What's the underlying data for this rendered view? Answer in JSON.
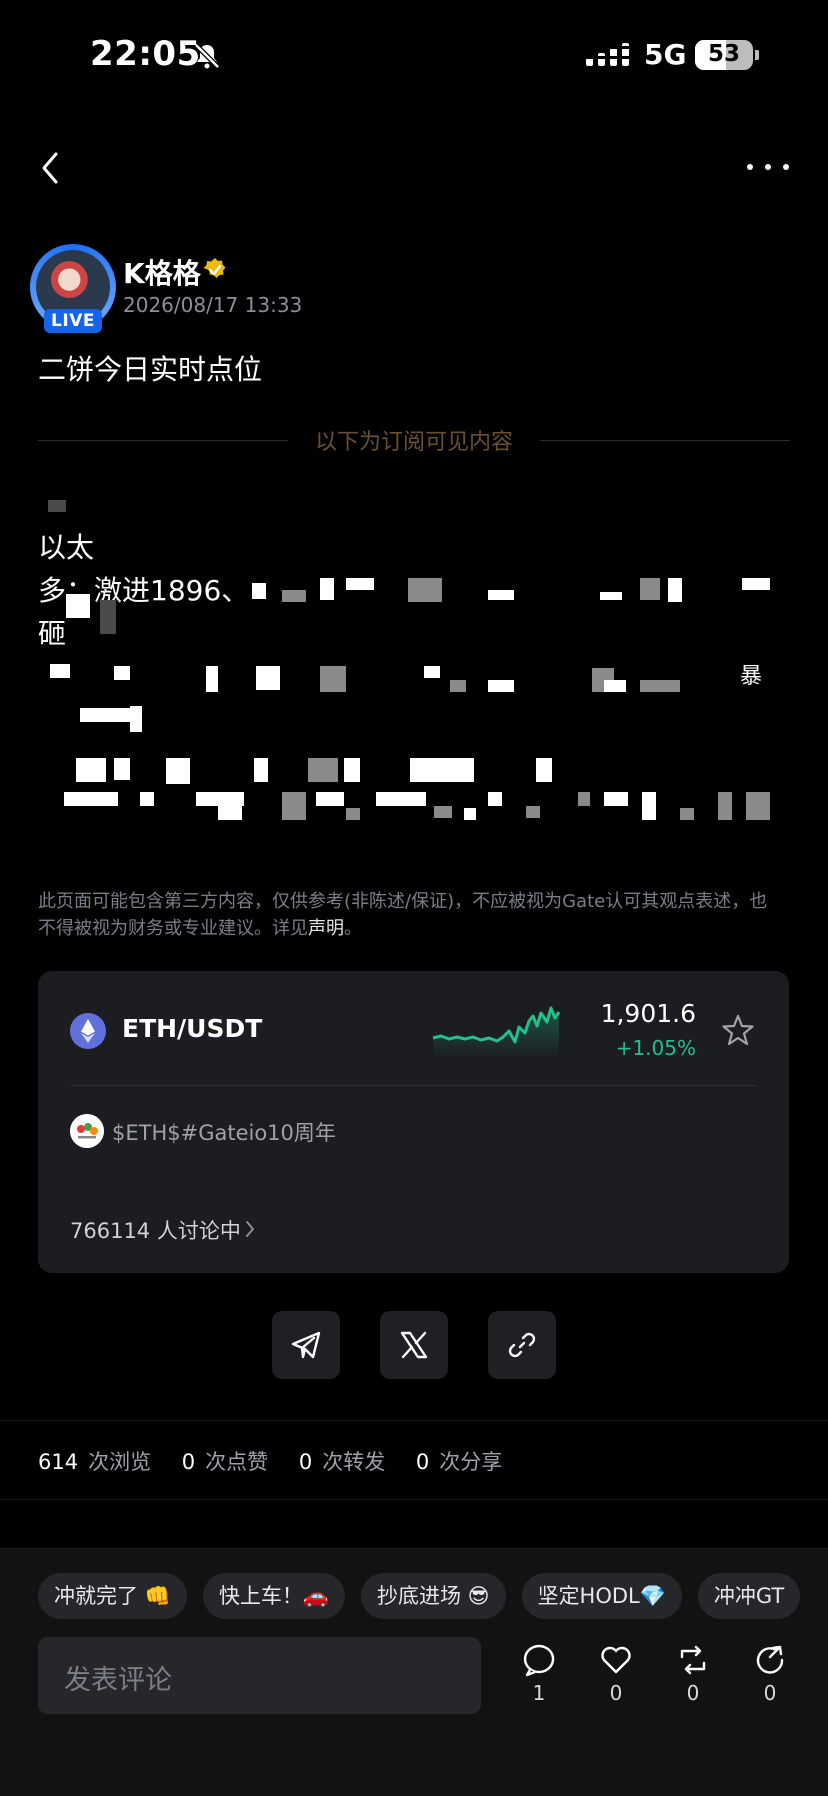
{
  "status_bar": {
    "time": "22:05",
    "network": "5G",
    "battery": "53"
  },
  "author": {
    "name": "K格格",
    "time": "2026/08/17 13:33",
    "live_label": "LIVE"
  },
  "post": {
    "title": "二饼今日实时点位",
    "subscriber_divider": "以下为订阅可见内容",
    "visible_lines": [
      "以太",
      "多：激进1896、",
      "砸",
      "暴"
    ]
  },
  "disclaimer": {
    "text": "此页面可能包含第三方内容，仅供参考(非陈述/保证)，不应被视为Gate认可其观点表述，也不得被视为财务或专业建议。详见",
    "link": "声明",
    "end": "。"
  },
  "card": {
    "pair": "ETH/USDT",
    "price": "1,901.6",
    "change": "+1.05%",
    "tags": "$ETH$#Gateio10周年",
    "discussion": "766114 人讨论中"
  },
  "stats": {
    "views": "614",
    "views_label": "次浏览",
    "likes": "0",
    "likes_label": "次点赞",
    "reposts": "0",
    "reposts_label": "次转发",
    "shares": "0",
    "shares_label": "次分享"
  },
  "quick_replies": [
    "冲就完了 👊",
    "快上车！🚗",
    "抄底进场 😎",
    "坚定HODL💎",
    "冲冲GT"
  ],
  "comment_box": {
    "placeholder": "发表评论"
  },
  "actions": {
    "comments": "1",
    "likes": "0",
    "reposts": "0",
    "shares": "0"
  },
  "colors": {
    "accent_green": "#22c08a",
    "live_blue": "#1565e8",
    "divider_text": "#6a5030"
  },
  "icons": [
    "bell-off-icon",
    "signal-icon",
    "back-icon",
    "more-icon",
    "verified-icon",
    "star-icon",
    "telegram-icon",
    "x-icon",
    "link-icon",
    "comment-icon",
    "heart-icon",
    "repost-icon",
    "share-icon"
  ]
}
